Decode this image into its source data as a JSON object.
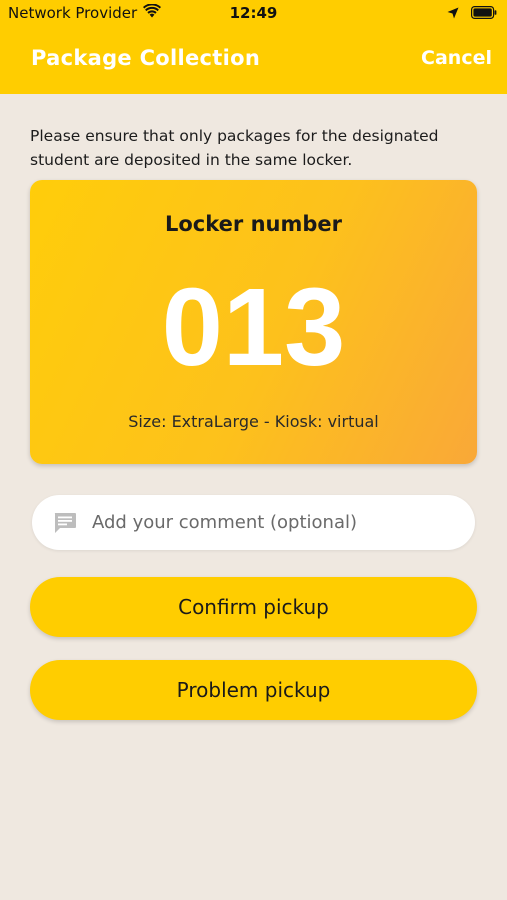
{
  "status_bar": {
    "carrier": "Network Provider",
    "time": "12:49"
  },
  "nav": {
    "title": "Package Collection",
    "cancel_label": "Cancel"
  },
  "instruction": "Please ensure that only packages for the designated student are deposited in the same locker.",
  "locker": {
    "label": "Locker number",
    "number": "013",
    "meta": "Size: ExtraLarge - Kiosk: virtual"
  },
  "comment": {
    "placeholder": "Add your comment (optional)",
    "value": ""
  },
  "buttons": {
    "confirm_label": "Confirm pickup",
    "problem_label": "Problem pickup"
  },
  "colors": {
    "accent": "#ffcd00",
    "background": "#efe8e0",
    "card_gradient_end": "#f9a838"
  },
  "icons": {
    "wifi": "wifi-icon",
    "location": "location-arrow-icon",
    "battery": "battery-icon",
    "comment": "comment-icon"
  }
}
